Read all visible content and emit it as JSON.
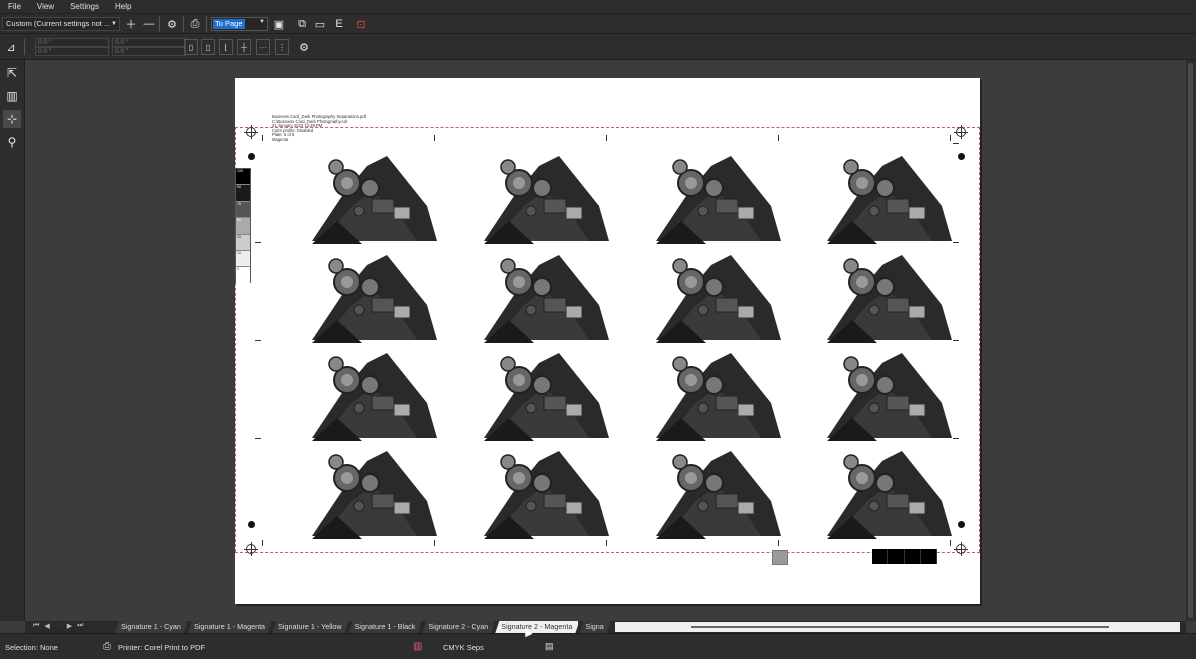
{
  "menu": [
    "File",
    "View",
    "Settings",
    "Help"
  ],
  "toolbar": {
    "preset_value": "Custom (Current settings not ...",
    "zoom_value": "To Page"
  },
  "property_bar": {
    "x1": "0.0 \"",
    "y1": "0.0 \"",
    "x2": "0.0 \"",
    "y2": "0.0 \""
  },
  "page_info": {
    "line1": "Business Card_Dark Photography Separations.pdf",
    "line2": "C:\\Business Card_Dark Photography.cdr",
    "line3": "21 January 2023 12:29 PM",
    "line4": "Color profile: Disabled",
    "line5": "Plate: 6 of 8",
    "line6": "Magenta"
  },
  "tint_labels": [
    "100",
    "90",
    "75",
    "50",
    "25",
    "10",
    "0"
  ],
  "tabs": [
    "Signature 1 - Cyan",
    "Signature 1 - Magenta",
    "Signature 1 - Yellow",
    "Signature 1 - Black",
    "Signature 2 - Cyan",
    "Signature 2 - Magenta",
    "Signa"
  ],
  "active_tab_index": 5,
  "status": {
    "selection": "Selection: None",
    "printer": "Printer: Corel Print to PDF",
    "mode": "CMYK Seps"
  },
  "icons": {
    "add": "plus-icon",
    "remove": "minus-icon",
    "settings": "gear-icon",
    "print": "printer-icon"
  }
}
